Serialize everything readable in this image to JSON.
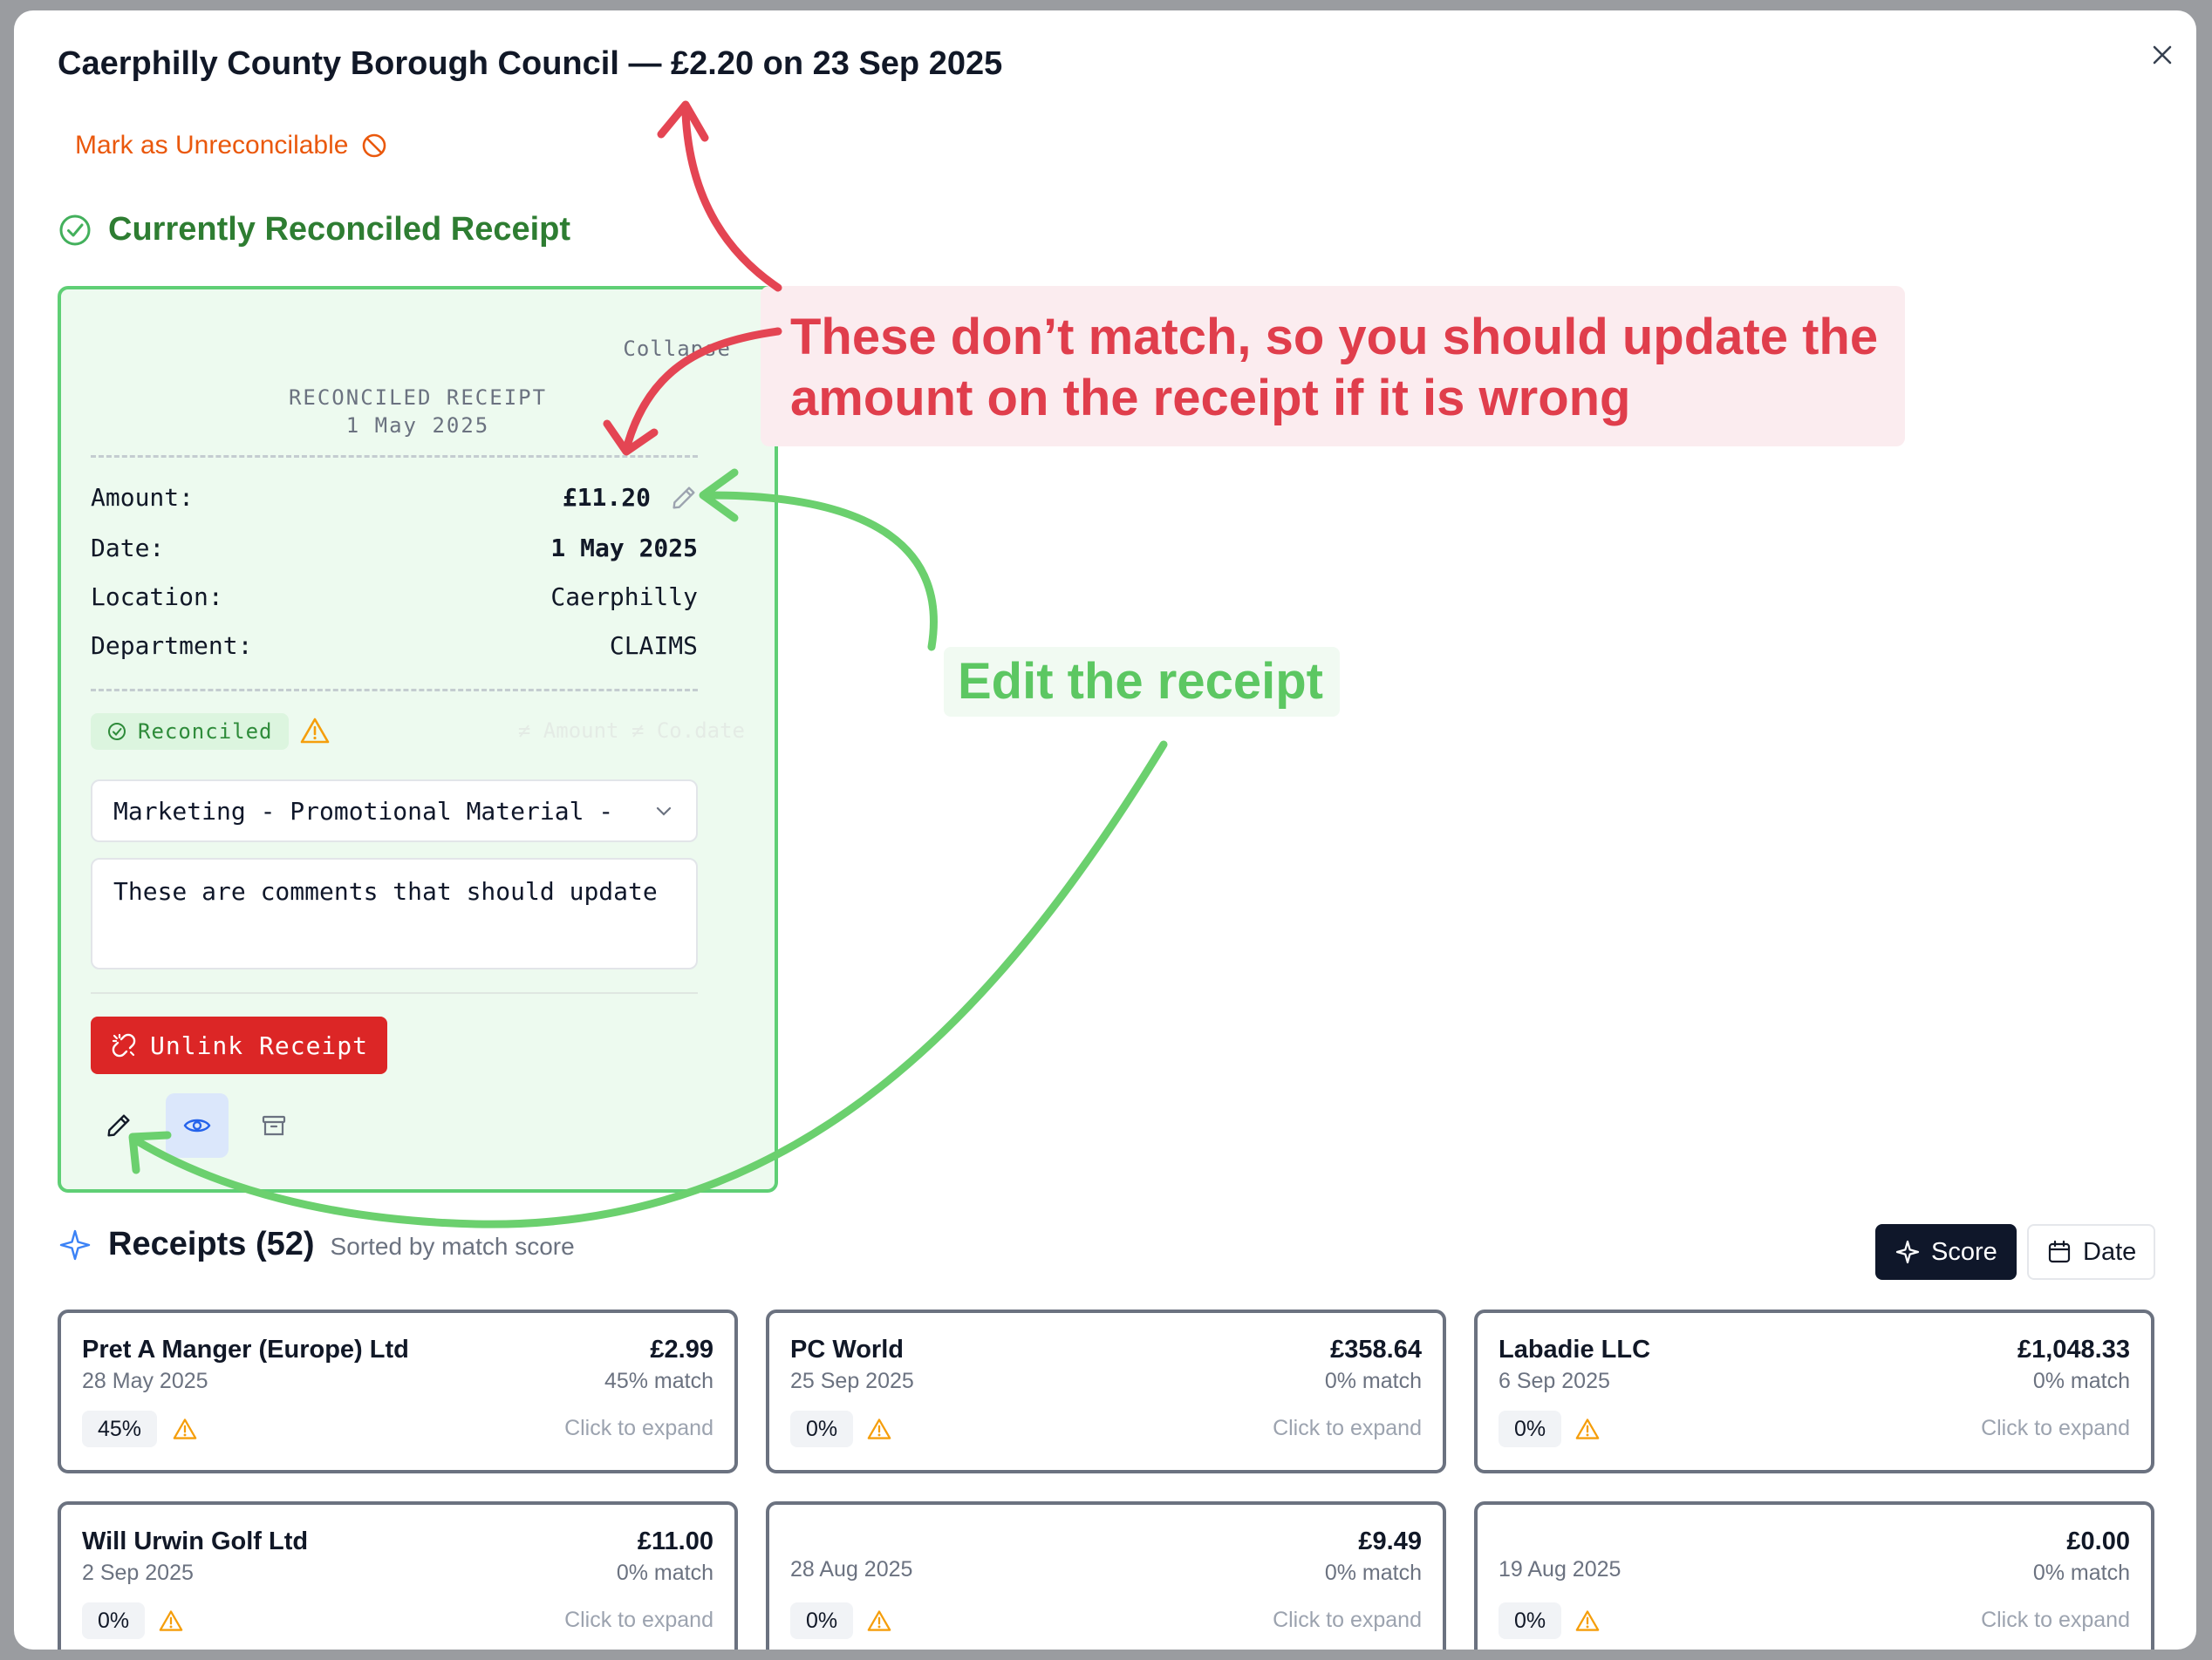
{
  "modal": {
    "title": "Caerphilly County Borough Council — £2.20 on 23 Sep 2025",
    "mark_unreconcilable": "Mark as Unreconcilable",
    "current_section_title": "Currently Reconciled Receipt"
  },
  "reconciled_receipt": {
    "collapse_label": "Collapse",
    "header": "RECONCILED RECEIPT",
    "header_date": "1 May 2025",
    "fields": {
      "amount_label": "Amount:",
      "amount_value": "£11.20",
      "date_label": "Date:",
      "date_value": "1 May 2025",
      "location_label": "Location:",
      "location_value": "Caerphilly",
      "department_label": "Department:",
      "department_value": "CLAIMS"
    },
    "status_badge": "Reconciled",
    "faint_text": "≠ Amount ≠ Co.date",
    "category_select_value": "Marketing - Promotional Material -",
    "comments_value": "These are comments that should update",
    "unlink_button": "Unlink Receipt"
  },
  "receipts_section": {
    "title": "Receipts (52)",
    "subtitle": "Sorted by match score",
    "score_button": "Score",
    "date_button": "Date",
    "items": [
      {
        "name": "Pret A Manger (Europe) Ltd",
        "amount": "£2.99",
        "date": "28 May 2025",
        "match": "45% match",
        "pct": "45%",
        "cta": "Click to expand"
      },
      {
        "name": "PC World",
        "amount": "£358.64",
        "date": "25 Sep 2025",
        "match": "0% match",
        "pct": "0%",
        "cta": "Click to expand"
      },
      {
        "name": "Labadie LLC",
        "amount": "£1,048.33",
        "date": "6 Sep 2025",
        "match": "0% match",
        "pct": "0%",
        "cta": "Click to expand"
      },
      {
        "name": "Will Urwin Golf Ltd",
        "amount": "£11.00",
        "date": "2 Sep 2025",
        "match": "0% match",
        "pct": "0%",
        "cta": "Click to expand"
      },
      {
        "name": "",
        "amount": "£9.49",
        "date": "28 Aug 2025",
        "match": "0% match",
        "pct": "0%",
        "cta": "Click to expand"
      },
      {
        "name": "",
        "amount": "£0.00",
        "date": "19 Aug 2025",
        "match": "0% match",
        "pct": "0%",
        "cta": "Click to expand"
      }
    ]
  },
  "annotations": {
    "red_line1": "These don’t match, so you should update the",
    "red_line2": "amount on the receipt if it is wrong",
    "green": "Edit the receipt"
  },
  "colors": {
    "accent_green": "#2e7d32",
    "card_border": "#5fcf75",
    "danger": "#dc2626",
    "warning": "#f59e0b",
    "orange": "#ea580c",
    "annotation_red": "#e03e4c",
    "annotation_green": "#5cc762"
  },
  "icons": [
    "close-icon",
    "ban-icon",
    "check-circle-icon",
    "pencil-icon",
    "alert-triangle-icon",
    "chevron-down-icon",
    "unlink-icon",
    "eye-icon",
    "archive-icon",
    "sparkle-icon",
    "calendar-icon"
  ]
}
